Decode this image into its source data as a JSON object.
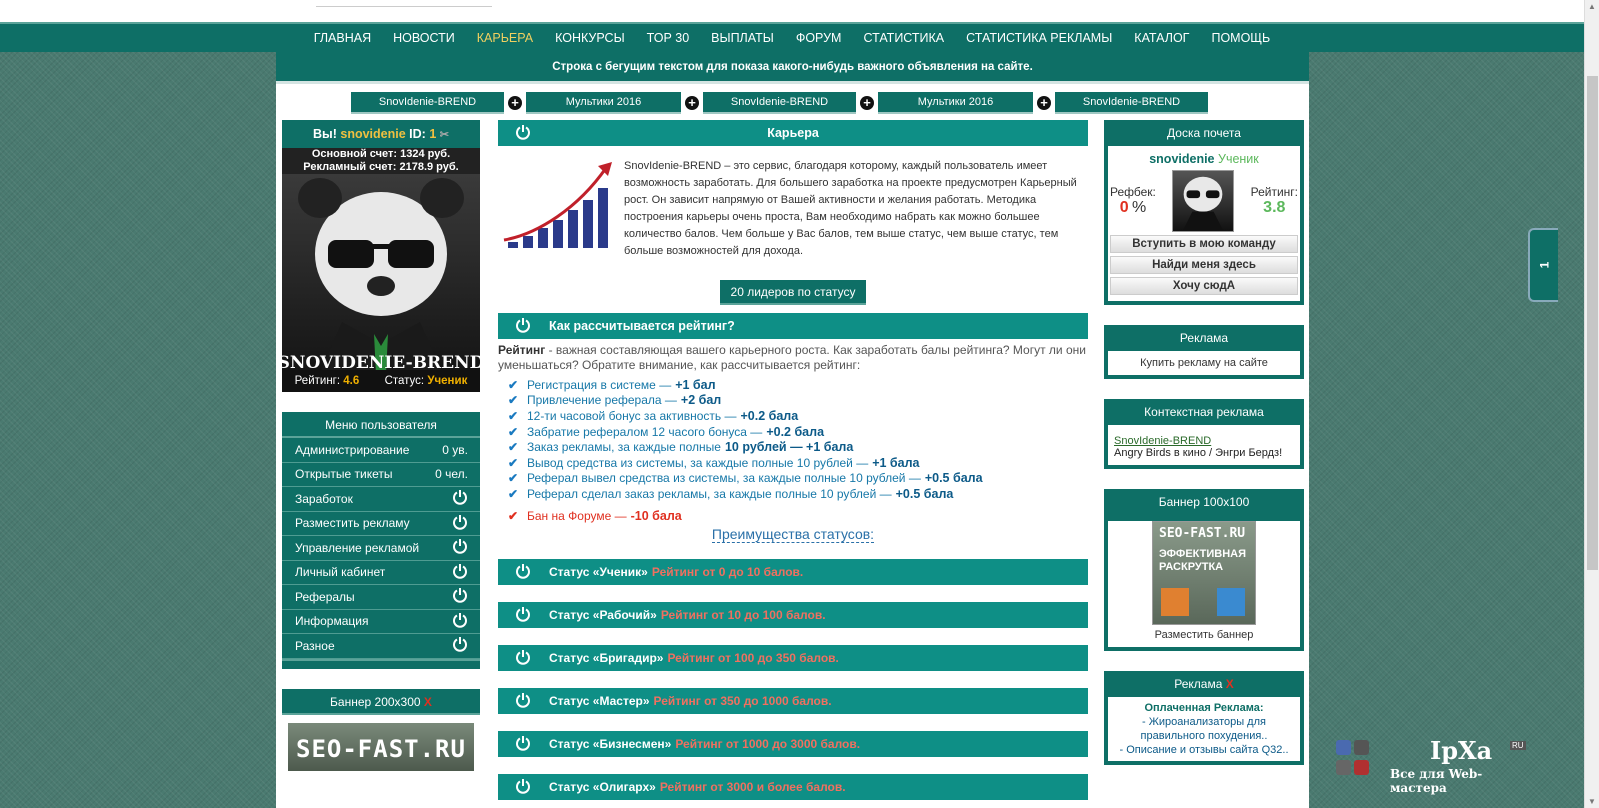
{
  "nav": [
    "ГЛАВНАЯ",
    "НОВОСТИ",
    "КАРЬЕРА",
    "КОНКУРСЫ",
    "ТОР 30",
    "ВЫПЛАТЫ",
    "ФОРУМ",
    "СТАТИСТИКА",
    "СТАТИСТИКА РЕКЛАМЫ",
    "КАТАЛОГ",
    "ПОМОЩЬ"
  ],
  "nav_active": 2,
  "marquee": "Строка с бегущим текстом для показа какого-нибудь важного объявления на сайте.",
  "tabs": [
    "SnovIdenie-BREND",
    "Мультики 2016",
    "SnovIdenie-BREND",
    "Мультики 2016",
    "SnovIdenie-BREND"
  ],
  "user": {
    "you": "Вы!",
    "name": "snovidenie",
    "id_label": "ID:",
    "id": "1",
    "main_account": "Основной счет: 1324 руб.",
    "ad_account": "Рекламный счет: 2178.9 руб.",
    "avatar_caption": "SNOVIDENIE-BREND",
    "rating_label": "Рейтинг:",
    "rating": "4.6",
    "status_label": "Статус:",
    "status": "Ученик"
  },
  "menu": {
    "title": "Меню пользователя",
    "items": [
      {
        "label": "Администрирование",
        "value": "0 ув."
      },
      {
        "label": "Открытые тикеты",
        "value": "0 чел."
      },
      {
        "label": "Заработок",
        "value": ""
      },
      {
        "label": "Разместить рекламу",
        "value": ""
      },
      {
        "label": "Управление рекламой",
        "value": ""
      },
      {
        "label": "Личный кабинет",
        "value": ""
      },
      {
        "label": "Рефералы",
        "value": ""
      },
      {
        "label": "Информация",
        "value": ""
      },
      {
        "label": "Разное",
        "value": ""
      }
    ]
  },
  "banner200": {
    "title": "Баннер 200х300",
    "close": "X",
    "img_text": "SEO-FAST.RU"
  },
  "career": {
    "title": "Карьера",
    "intro": "SnovIdenie-BREND – это сервис, благодаря которому, каждый пользователь имеет возможность заработать. Для большего заработка на проекте предусмотрен Карьерный рост. Он зависит напрямую от Вашей активности и желания работать. Методика построения карьеры очень проста, Вам необходимо набрать как можно большее количество балов. Чем больше у Вас балов, тем выше статус, чем выше статус, тем больше возможностей для дохода.",
    "leaders_btn": "20 лидеров по статусу",
    "rating_title": "Как рассчитывается рейтинг?",
    "rating_lead": "Рейтинг",
    "rating_text": " - важная составляющая вашего карьерного роста. Как заработать балы рейтинга? Могут ли они уменьшаться? Обратите внимание, как рассчитывается рейтинг:",
    "rules": [
      {
        "t": "Регистрация в системе —",
        "v": "+1 бал"
      },
      {
        "t": "Привлечение реферала —",
        "v": "+2 бал"
      },
      {
        "t": "12-ти часовой бонус за активность —",
        "v": "+0.2 бала"
      },
      {
        "t": "Забратие рефералом 12 часого бонуса —",
        "v": "+0.2 бала"
      },
      {
        "t": "Заказ рекламы, за каждые полные",
        "v": "10 рублей — +1 бала"
      },
      {
        "t": "Вывод средства из системы, за каждые полные 10 рублей —",
        "v": "+1 бала"
      },
      {
        "t": "Реферал вывел средства из системы, за каждые полные 10 рублей —",
        "v": "+0.5 бала"
      },
      {
        "t": "Реферал сделал заказ рекламы, за каждые полные 10 рублей —",
        "v": "+0.5 бала"
      }
    ],
    "ban": {
      "t": "Бан на Форуме —",
      "v": "-10 бала"
    },
    "advantages": "Преимущества статусов:",
    "statuses": [
      {
        "name": "Статус «Ученик»",
        "range": "Рейтинг от 0 до 10 балов."
      },
      {
        "name": "Статус «Рабочий»",
        "range": "Рейтинг от 10 до 100 балов."
      },
      {
        "name": "Статус «Бригадир»",
        "range": "Рейтинг от 100 до 350 балов."
      },
      {
        "name": "Статус «Мастер»",
        "range": "Рейтинг от 350 до 1000 балов."
      },
      {
        "name": "Статус «Бизнесмен»",
        "range": "Рейтинг от 1000 до 3000 балов."
      },
      {
        "name": "Статус «Олигарх»",
        "range": "Рейтинг от 3000 и более балов."
      }
    ]
  },
  "honor": {
    "title": "Доска почета",
    "name": "snovidenie",
    "status": "Ученик",
    "refback_label": "Рефбек:",
    "refback": "0",
    "refback_unit": "%",
    "rating_label": "Рейтинг:",
    "rating": "3.8",
    "buttons": [
      "Вступить в мою команду",
      "Найди меня здесь",
      "Хочу сюдА"
    ]
  },
  "ad": {
    "title": "Реклама",
    "text": "Купить рекламу на сайте"
  },
  "context": {
    "title": "Контекстная реклама",
    "link": "SnovIdenie-BREND",
    "text": "Angry Birds в кино / Энгри Бердз!"
  },
  "banner100": {
    "title": "Баннер 100х100",
    "t1": "SEO-FAST.RU",
    "t2": "ЭФФЕКТИВНАЯ РАСКРУТКА",
    "link": "Разместить баннер"
  },
  "ads": {
    "title": "Реклама",
    "close": "X",
    "head": "Оплаченная Реклама:",
    "items": [
      "- Жироанализаторы для правильного похудения..",
      "- Описание и отзывы сайта Q32.."
    ]
  },
  "sidetab": "1",
  "ipxa": {
    "logo": "IpXa",
    "ru": "RU",
    "sub": "Все для Web-мастера"
  },
  "colors": {
    "accent": "#0e6f66",
    "header": "#0e8f86",
    "red": "#e03020",
    "gold": "#f0b000"
  }
}
